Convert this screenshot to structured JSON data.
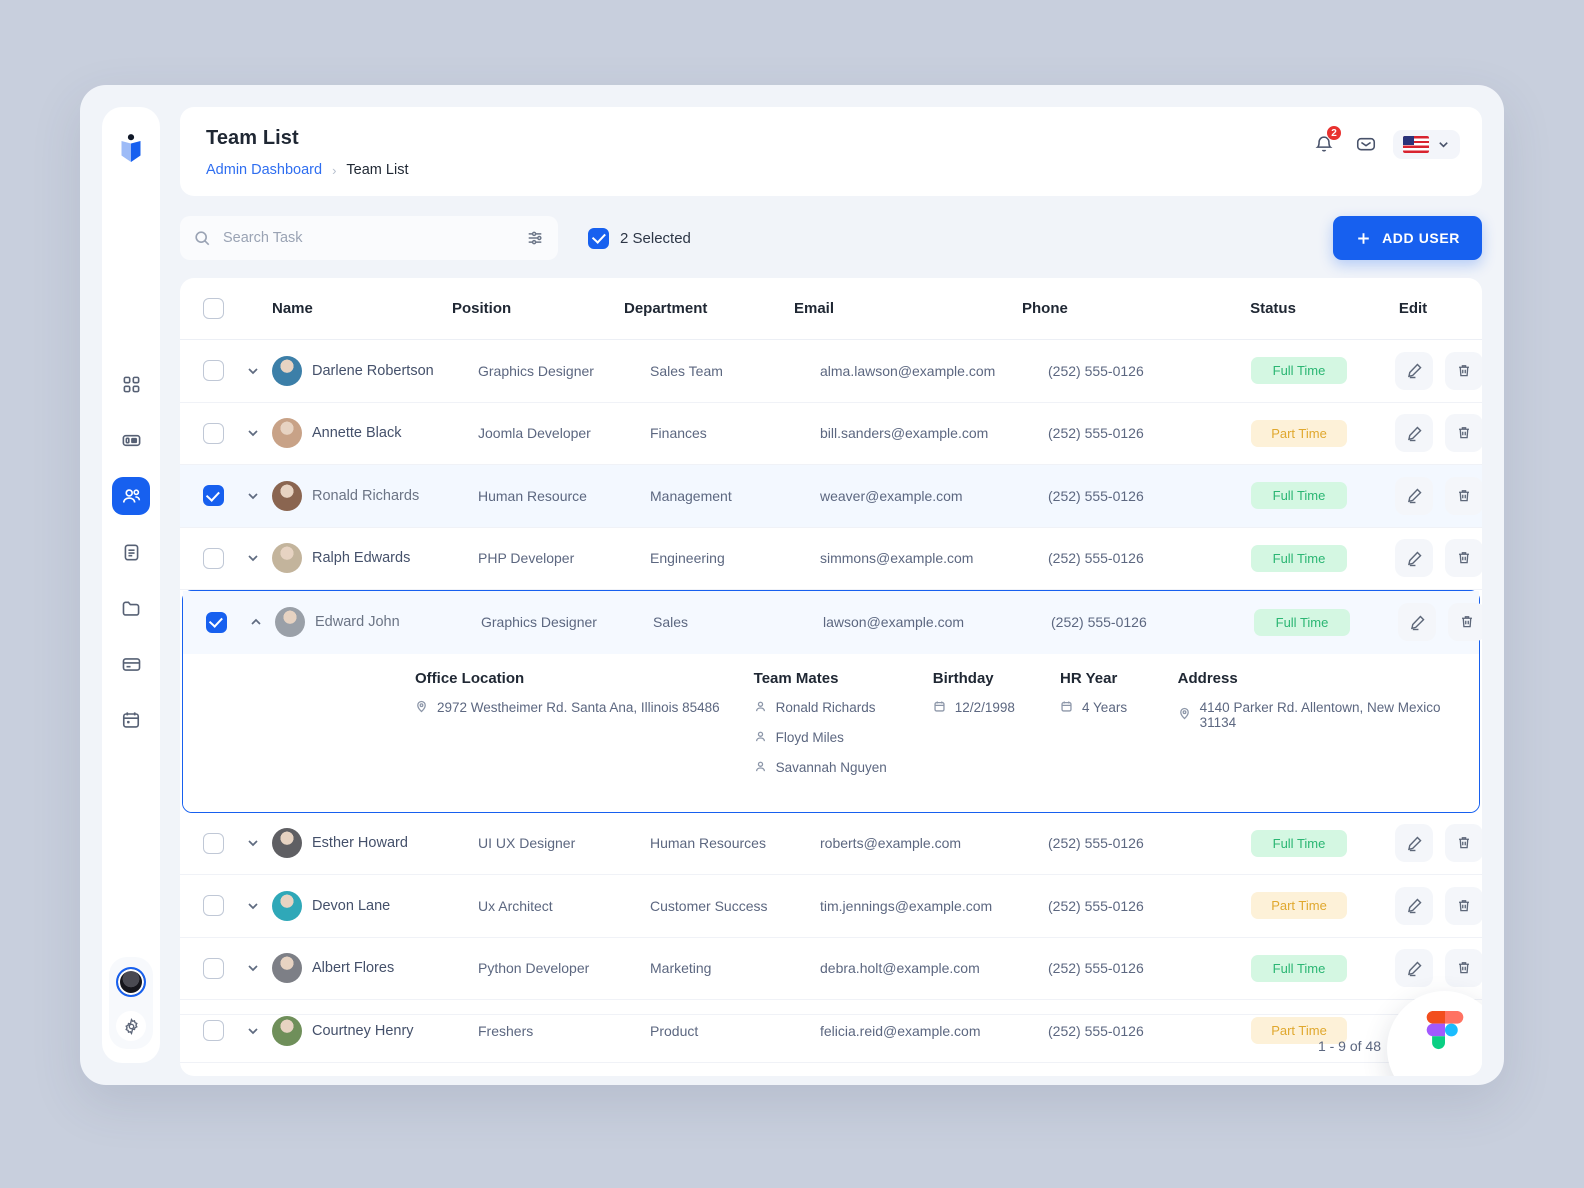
{
  "header": {
    "title": "Team List",
    "breadcrumb_parent": "Admin Dashboard",
    "breadcrumb_sep": "›",
    "breadcrumb_current": "Team List",
    "notification_count": "2"
  },
  "toolbar": {
    "search_placeholder": "Search Task",
    "search_value": "",
    "selected_label": "2 Selected",
    "add_user_label": "ADD USER"
  },
  "table": {
    "columns": [
      "Name",
      "Position",
      "Department",
      "Email",
      "Phone",
      "Status",
      "Edit"
    ],
    "rows": [
      {
        "name": "Darlene Robertson",
        "position": "Graphics Designer",
        "department": "Sales Team",
        "email": "alma.lawson@example.com",
        "phone": "(252) 555-0126",
        "status": "Full Time",
        "status_kind": "full",
        "checked": false,
        "expanded": false
      },
      {
        "name": "Annette Black",
        "position": "Joomla Developer",
        "department": "Finances",
        "email": "bill.sanders@example.com",
        "phone": "(252) 555-0126",
        "status": "Part Time",
        "status_kind": "part",
        "checked": false,
        "expanded": false
      },
      {
        "name": "Ronald Richards",
        "position": "Human Resource",
        "department": "Management",
        "email": "weaver@example.com",
        "phone": "(252) 555-0126",
        "status": "Full Time",
        "status_kind": "full",
        "checked": true,
        "expanded": false
      },
      {
        "name": "Ralph Edwards",
        "position": "PHP Developer",
        "department": "Engineering",
        "email": "simmons@example.com",
        "phone": "(252) 555-0126",
        "status": "Full Time",
        "status_kind": "full",
        "checked": false,
        "expanded": false
      },
      {
        "name": "Edward John",
        "position": "Graphics Designer",
        "department": "Sales",
        "email": "lawson@example.com",
        "phone": "(252) 555-0126",
        "status": "Full Time",
        "status_kind": "full",
        "checked": true,
        "expanded": true
      },
      {
        "name": "Esther Howard",
        "position": "UI UX Designer",
        "department": "Human Resources",
        "email": "roberts@example.com",
        "phone": "(252) 555-0126",
        "status": "Full Time",
        "status_kind": "full",
        "checked": false,
        "expanded": false
      },
      {
        "name": "Devon Lane",
        "position": "Ux Architect",
        "department": "Customer Success",
        "email": "tim.jennings@example.com",
        "phone": "(252) 555-0126",
        "status": "Part Time",
        "status_kind": "part",
        "checked": false,
        "expanded": false
      },
      {
        "name": "Albert Flores",
        "position": "Python Developer",
        "department": "Marketing",
        "email": "debra.holt@example.com",
        "phone": "(252) 555-0126",
        "status": "Full Time",
        "status_kind": "full",
        "checked": false,
        "expanded": false
      },
      {
        "name": "Courtney Henry",
        "position": "Freshers",
        "department": "Product",
        "email": "felicia.reid@example.com",
        "phone": "(252) 555-0126",
        "status": "Part Time",
        "status_kind": "part",
        "checked": false,
        "expanded": false
      }
    ]
  },
  "expanded_detail": {
    "office_location_label": "Office Location",
    "office_location_value": "2972 Westheimer Rd. Santa Ana, Illinois 85486",
    "team_mates_label": "Team Mates",
    "team_mates": [
      "Ronald Richards",
      "Floyd Miles",
      "Savannah Nguyen"
    ],
    "birthday_label": "Birthday",
    "birthday_value": "12/2/1998",
    "hr_year_label": "HR Year",
    "hr_year_value": "4 Years",
    "address_label": "Address",
    "address_value": "4140 Parker Rd. Allentown, New Mexico 31134"
  },
  "pagination": {
    "range_text": "1 - 9 of 48"
  },
  "sidebar": {
    "items": [
      {
        "icon": "grid-icon",
        "name": "dashboard",
        "active": false
      },
      {
        "icon": "layout-icon",
        "name": "boards",
        "active": false
      },
      {
        "icon": "users-icon",
        "name": "team",
        "active": true
      },
      {
        "icon": "document-icon",
        "name": "documents",
        "active": false
      },
      {
        "icon": "folder-icon",
        "name": "files",
        "active": false
      },
      {
        "icon": "card-icon",
        "name": "billing",
        "active": false
      },
      {
        "icon": "calendar-icon",
        "name": "calendar",
        "active": false
      }
    ]
  },
  "colors": {
    "accent": "#1760ef",
    "full_time_bg": "#d4f7e2",
    "full_time_text": "#2bb673",
    "part_time_bg": "#fdf1d8",
    "part_time_text": "#e0a82e",
    "badge_red": "#e8312f"
  }
}
